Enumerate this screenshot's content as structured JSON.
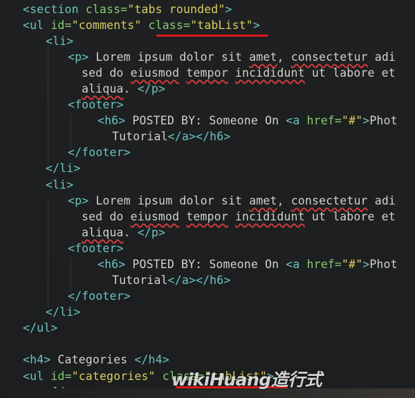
{
  "code": {
    "l1": {
      "t1": "<section ",
      "a1": "class=",
      "s1": "\"tabs rounded\"",
      "t2": ">"
    },
    "l2": {
      "t1": "<ul ",
      "a1": "id=",
      "s1": "\"comments\"",
      "a2": "class=",
      "s2": "\"tabList\"",
      "t2": ">"
    },
    "l3": {
      "t1": "<li>"
    },
    "l4": {
      "t1": "<p>",
      "x1": " Lorem ipsum dolor sit ",
      "w1": "amet",
      "x2": ", ",
      "w2": "consectetur",
      "x3": " adi"
    },
    "l5": {
      "x1": "sed do ",
      "w1": "eiusmod",
      "x2": " ",
      "w2": "tempor",
      "x3": " ",
      "w3": "incididunt",
      "x4": " ut labore et"
    },
    "l6": {
      "w1": "aliqua",
      "x1": ". ",
      "t1": "</p>"
    },
    "l7": {
      "t1": "<footer>"
    },
    "l8": {
      "t1": "<h6>",
      "x1": " POSTED BY: Someone On ",
      "t2": "<a ",
      "a1": "href=",
      "s1": "\"#\"",
      "t3": ">",
      "x2": "Phot"
    },
    "l9": {
      "x1": "Tutorial",
      "t1": "</a></h6>"
    },
    "l10": {
      "t1": "</footer>"
    },
    "l11": {
      "t1": "</li>"
    },
    "l12": {
      "t1": "<li>"
    },
    "l13": {
      "t1": "<p>",
      "x1": " Lorem ipsum dolor sit ",
      "w1": "amet",
      "x2": ", ",
      "w2": "consectetur",
      "x3": " adi"
    },
    "l14": {
      "x1": "sed do ",
      "w1": "eiusmod",
      "x2": " ",
      "w2": "tempor",
      "x3": " ",
      "w3": "incididunt",
      "x4": " ut labore et"
    },
    "l15": {
      "w1": "aliqua",
      "x1": ". ",
      "t1": "</p>"
    },
    "l16": {
      "t1": "<footer>"
    },
    "l17": {
      "t1": "<h6>",
      "x1": " POSTED BY: Someone On ",
      "t2": "<a ",
      "a1": "href=",
      "s1": "\"#\"",
      "t3": ">",
      "x2": "Phot"
    },
    "l18": {
      "x1": "Tutorial",
      "t1": "</a></h6>"
    },
    "l19": {
      "t1": "</footer>"
    },
    "l20": {
      "t1": "</li>"
    },
    "l21": {
      "t1": "</ul>"
    },
    "l23": {
      "t1": "<h4>",
      "x1": " Categories ",
      "t2": "</h4>"
    },
    "l24": {
      "t1": "<ul ",
      "a1": "id=",
      "s1": "\"categories\"",
      "a2": "class=",
      "s2": "\"tabList\"",
      "t2": ">"
    },
    "l25": {
      "t1": "<li>"
    }
  },
  "watermark": "wikiHuang造行式",
  "colors": {
    "background": "#1e2021",
    "tag": "#6bc5c1",
    "attribute": "#86cc72",
    "string": "#d8cf62",
    "text": "#d3d3cb",
    "annotation": "#e01a1a"
  }
}
